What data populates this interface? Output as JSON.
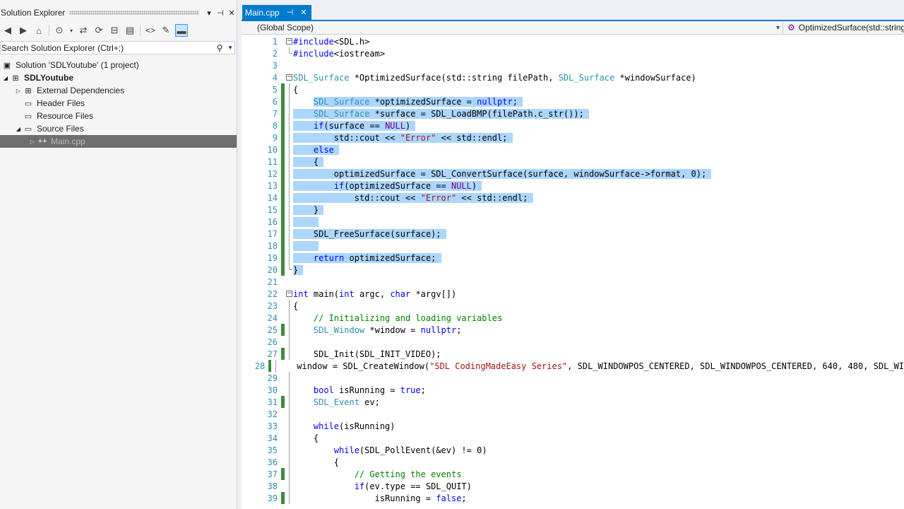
{
  "solution_explorer": {
    "title": "Solution Explorer",
    "search_placeholder": "Search Solution Explorer (Ctrl+;)",
    "tree": [
      {
        "label": "Solution 'SDLYoutube' (1 project)",
        "icon": "solution-icon"
      },
      {
        "label": "SDLYoutube",
        "icon": "cpp-project-icon"
      },
      {
        "label": "External Dependencies",
        "icon": "external-deps-icon"
      },
      {
        "label": "Header Files",
        "icon": "filter-folder-icon"
      },
      {
        "label": "Resource Files",
        "icon": "filter-folder-icon"
      },
      {
        "label": "Source Files",
        "icon": "filter-folder-icon"
      },
      {
        "label": "Main.cpp",
        "icon": "cpp-file-icon"
      }
    ]
  },
  "editor": {
    "tab": {
      "label": "Main.cpp"
    },
    "nav": {
      "scope": "(Global Scope)",
      "member": "OptimizedSurface(std::string filePath, SDL_Surface * windowSurface)"
    },
    "lines": [
      {
        "num": "1",
        "code": "#include<SDL.h>"
      },
      {
        "num": "2",
        "code": "#include<iostream>"
      },
      {
        "num": "3",
        "code": ""
      },
      {
        "num": "4",
        "code": "SDL_Surface *OptimizedSurface(std::string filePath, SDL_Surface *windowSurface)"
      },
      {
        "num": "5",
        "code": "{"
      },
      {
        "num": "6",
        "code": "    SDL_Surface *optimizedSurface = nullptr;"
      },
      {
        "num": "7",
        "code": "    SDL_Surface *surface = SDL_LoadBMP(filePath.c_str());"
      },
      {
        "num": "8",
        "code": "    if(surface == NULL)"
      },
      {
        "num": "9",
        "code": "        std::cout << \"Error\" << std::endl;"
      },
      {
        "num": "10",
        "code": "    else"
      },
      {
        "num": "11",
        "code": "    {"
      },
      {
        "num": "12",
        "code": "        optimizedSurface = SDL_ConvertSurface(surface, windowSurface->format, 0);"
      },
      {
        "num": "13",
        "code": "        if(optimizedSurface == NULL)"
      },
      {
        "num": "14",
        "code": "            std::cout << \"Error\" << std::endl;"
      },
      {
        "num": "15",
        "code": "    }"
      },
      {
        "num": "16",
        "code": ""
      },
      {
        "num": "17",
        "code": "    SDL_FreeSurface(surface);"
      },
      {
        "num": "18",
        "code": ""
      },
      {
        "num": "19",
        "code": "    return optimizedSurface;"
      },
      {
        "num": "20",
        "code": "}"
      },
      {
        "num": "21",
        "code": ""
      },
      {
        "num": "22",
        "code": "int main(int argc, char *argv[])"
      },
      {
        "num": "23",
        "code": "{"
      },
      {
        "num": "24",
        "code": "    // Initializing and loading variables"
      },
      {
        "num": "25",
        "code": "    SDL_Window *window = nullptr;"
      },
      {
        "num": "26",
        "code": ""
      },
      {
        "num": "27",
        "code": "    SDL_Init(SDL_INIT_VIDEO);"
      },
      {
        "num": "28",
        "code": "    window = SDL_CreateWindow(\"SDL CodingMadeEasy Series\", SDL_WINDOWPOS_CENTERED, SDL_WINDOWPOS_CENTERED, 640, 480, SDL_WI"
      },
      {
        "num": "29",
        "code": ""
      },
      {
        "num": "30",
        "code": "    bool isRunning = true;"
      },
      {
        "num": "31",
        "code": "    SDL_Event ev;"
      },
      {
        "num": "32",
        "code": ""
      },
      {
        "num": "33",
        "code": "    while(isRunning)"
      },
      {
        "num": "34",
        "code": "    {"
      },
      {
        "num": "35",
        "code": "        while(SDL_PollEvent(&ev) != 0)"
      },
      {
        "num": "36",
        "code": "        {"
      },
      {
        "num": "37",
        "code": "            // Getting the events"
      },
      {
        "num": "38",
        "code": "            if(ev.type == SDL_QUIT)"
      },
      {
        "num": "39",
        "code": "                isRunning = false;"
      }
    ]
  },
  "colors": {
    "accent": "#007acc",
    "selection": "#add6ff",
    "change_marker": "#3c8c3c",
    "keyword": "#0000ff",
    "type": "#2b91af",
    "string": "#a31515",
    "comment": "#008000"
  }
}
